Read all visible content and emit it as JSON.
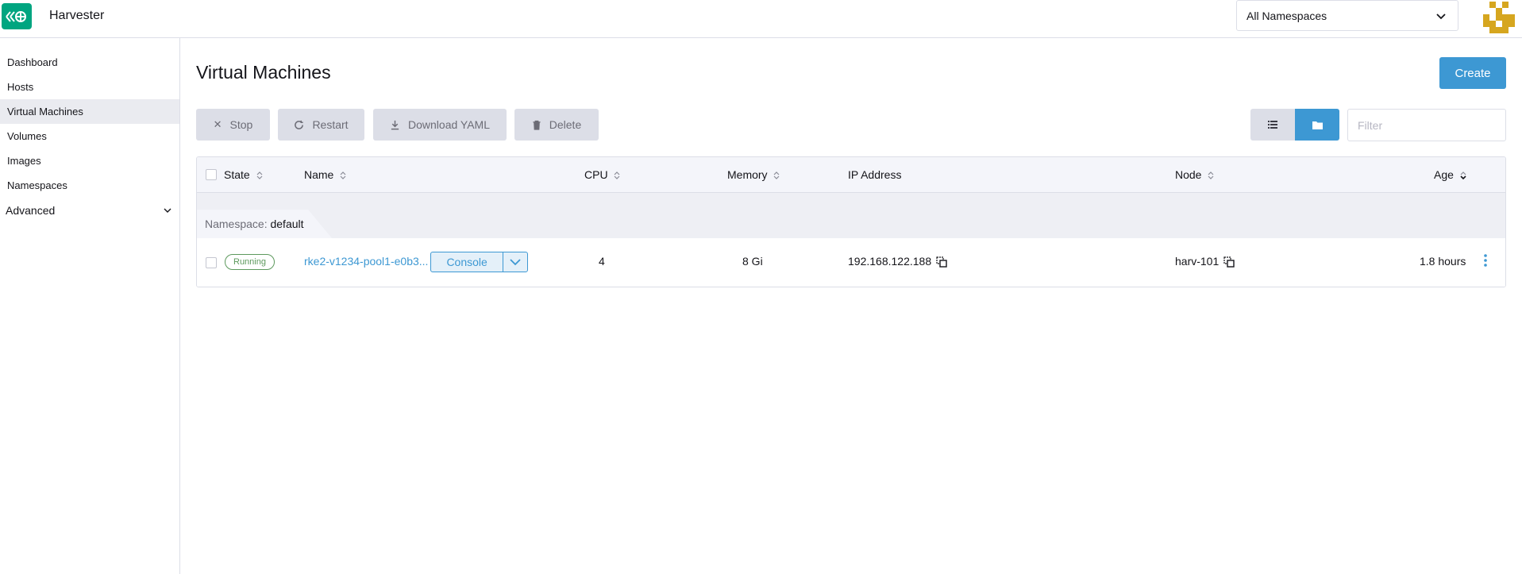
{
  "header": {
    "app_title": "Harvester",
    "namespace_selector": "All Namespaces"
  },
  "sidebar": {
    "items": [
      {
        "label": "Dashboard"
      },
      {
        "label": "Hosts"
      },
      {
        "label": "Virtual Machines",
        "active": true
      },
      {
        "label": "Volumes"
      },
      {
        "label": "Images"
      },
      {
        "label": "Namespaces"
      }
    ],
    "group_label": "Advanced"
  },
  "page": {
    "title": "Virtual Machines",
    "create_label": "Create"
  },
  "toolbar": {
    "stop_label": "Stop",
    "restart_label": "Restart",
    "download_yaml_label": "Download YAML",
    "delete_label": "Delete",
    "filter_placeholder": "Filter"
  },
  "table": {
    "columns": [
      "State",
      "Name",
      "CPU",
      "Memory",
      "IP Address",
      "Node",
      "Age"
    ],
    "group": {
      "key": "Namespace:",
      "value": "default"
    },
    "rows": [
      {
        "state": "Running",
        "name": "rke2-v1234-pool1-e0b3...",
        "console_label": "Console",
        "cpu": "4",
        "memory": "8 Gi",
        "ip": "192.168.122.188",
        "node": "harv-101",
        "age": "1.8 hours"
      }
    ]
  },
  "colors": {
    "primary": "#3d98d3",
    "brand": "#00a580",
    "running": "#5d995d",
    "avatar": "#d6a61f"
  }
}
